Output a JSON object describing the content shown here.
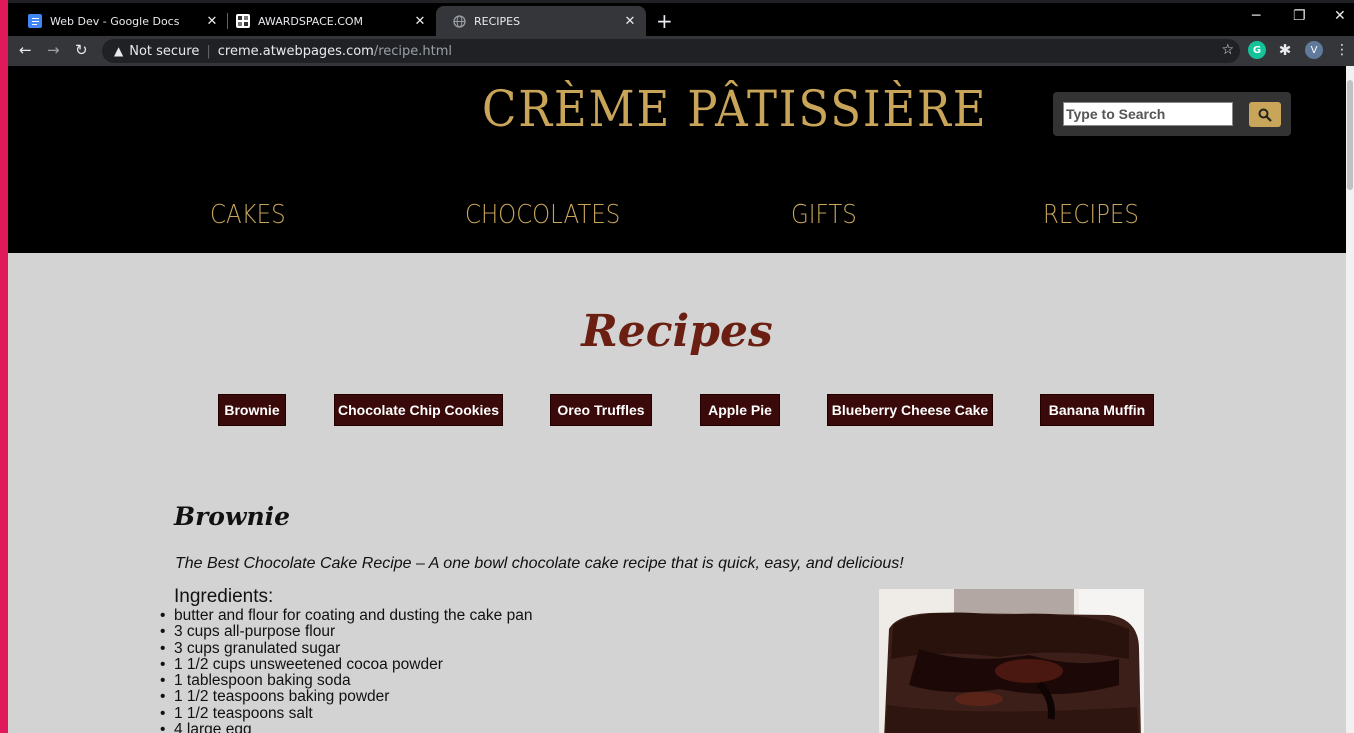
{
  "browser": {
    "tabs": [
      {
        "title": "Web Dev - Google Docs",
        "close": "✕"
      },
      {
        "title": "AWARDSPACE.COM",
        "close": "✕"
      },
      {
        "title": "RECIPES",
        "close": "✕"
      }
    ],
    "new_tab": "+",
    "window_controls": {
      "minimize": "─",
      "restore": "❐",
      "close": "✕"
    },
    "nav": {
      "back": "←",
      "forward": "→",
      "reload": "↻"
    },
    "security_label": "Not secure",
    "url_host": "creme.atwebpages.com",
    "url_path": "/recipe.html",
    "bookmark_icon": "☆",
    "profile_initial": "V",
    "grammarly_letter": "G"
  },
  "site": {
    "brand": "CRÈME PÂTISSIÈRE",
    "search_placeholder": "Type to Search",
    "menu": [
      "CAKES",
      "CHOCOLATES",
      "GIFTS",
      "RECIPES"
    ],
    "heading": "Recipes",
    "recipe_buttons": [
      "Brownie",
      "Chocolate Chip Cookies",
      "Oreo Truffles",
      "Apple Pie",
      "Blueberry Cheese Cake",
      "Banana Muffin"
    ],
    "recipe": {
      "title": "Brownie",
      "description": "The Best Chocolate Cake Recipe – A one bowl chocolate cake recipe that is quick, easy, and delicious!",
      "ingredients_heading": "Ingredients:",
      "ingredients": [
        "butter and flour for coating and dusting the cake pan",
        "3 cups all-purpose flour",
        "3 cups granulated sugar",
        "1 1/2 cups unsweetened cocoa powder",
        "1 tablespoon baking soda",
        "1 1/2 teaspoons baking powder",
        "1 1/2 teaspoons salt",
        "4 large egg"
      ]
    }
  },
  "colors": {
    "gold": "#c9a55a",
    "header_bg": "#000000",
    "page_bg": "#d3d3d3",
    "button_bg": "#3a0a0a",
    "heading": "#6b1e12"
  }
}
